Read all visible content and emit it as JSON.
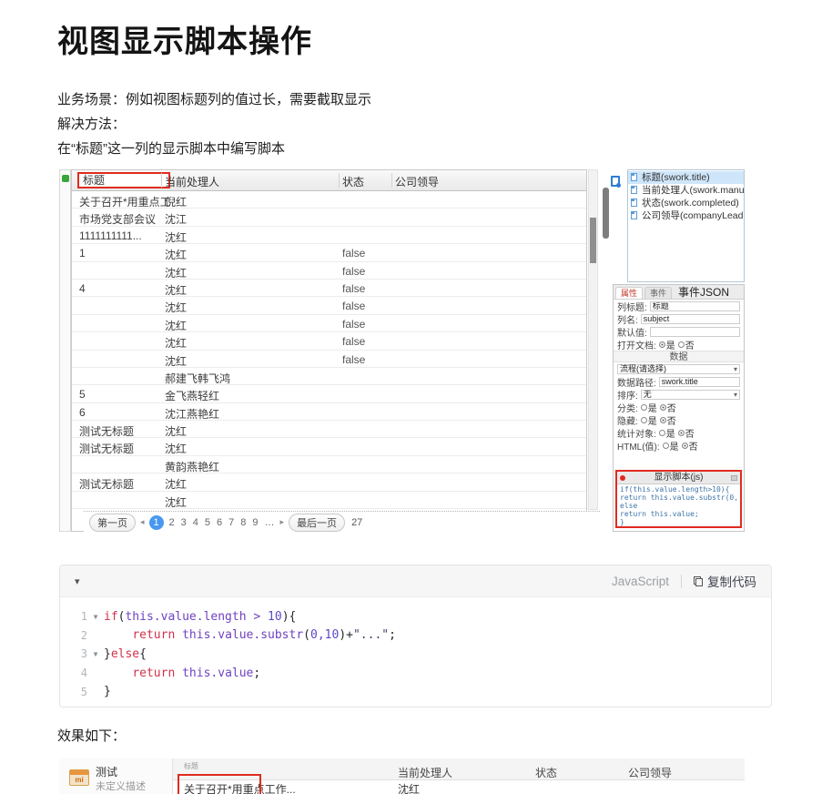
{
  "page": {
    "title": "视图显示脚本操作",
    "intro_line1": "业务场景：例如视图标题列的值过长，需要截取显示",
    "intro_line2": "解决方法：",
    "intro_line3": "在“标题”这一列的显示脚本中编写脚本",
    "effect_label": "效果如下："
  },
  "designer": {
    "columns": {
      "title": "标题",
      "handler": "当前处理人",
      "status": "状态",
      "leader": "公司领导"
    },
    "rows": [
      {
        "title": "关于召开*用重点工",
        "handler": "倪红",
        "status": ""
      },
      {
        "title": "市场党支部会议",
        "handler": "沈江",
        "status": ""
      },
      {
        "title": "1111111111...",
        "handler": "沈红",
        "status": ""
      },
      {
        "title": "1",
        "handler": "沈红",
        "status": "false"
      },
      {
        "title": "",
        "handler": "沈红",
        "status": "false"
      },
      {
        "title": "4",
        "handler": "沈红",
        "status": "false"
      },
      {
        "title": "",
        "handler": "沈红",
        "status": "false"
      },
      {
        "title": "",
        "handler": "沈红",
        "status": "false"
      },
      {
        "title": "",
        "handler": "沈红",
        "status": "false"
      },
      {
        "title": "",
        "handler": "沈红",
        "status": "false"
      },
      {
        "title": "",
        "handler": "郝建飞韩飞鸿",
        "status": ""
      },
      {
        "title": "5",
        "handler": "金飞燕轻红",
        "status": ""
      },
      {
        "title": "6",
        "handler": "沈江燕艳红",
        "status": ""
      },
      {
        "title": "测试无标题",
        "handler": "沈红",
        "status": ""
      },
      {
        "title": "测试无标题",
        "handler": "沈红",
        "status": ""
      },
      {
        "title": "",
        "handler": "黄韵燕艳红",
        "status": ""
      },
      {
        "title": "测试无标题",
        "handler": "沈红",
        "status": ""
      },
      {
        "title": "",
        "handler": "沈红",
        "status": ""
      }
    ],
    "pagination": {
      "first": "第一页",
      "prev": "◂",
      "pages": [
        "1",
        "2",
        "3",
        "4",
        "5",
        "6",
        "7",
        "8",
        "9"
      ],
      "current": "1",
      "ellipsis": "…",
      "next": "▸",
      "last": "最后一页",
      "total": "27"
    },
    "tree": [
      {
        "label": "标题(swork.title)",
        "selected": true
      },
      {
        "label": "当前处理人(swork.manual…",
        "selected": false
      },
      {
        "label": "状态(swork.completed)",
        "selected": false
      },
      {
        "label": "公司领导(companyLeader)",
        "selected": false
      }
    ],
    "props": {
      "tabs": [
        {
          "label": "属性",
          "active": true
        },
        {
          "label": "事件",
          "active": false
        }
      ],
      "panel_title": "事件JSON",
      "fields": [
        {
          "kind": "input",
          "label": "列标题:",
          "value": "标题"
        },
        {
          "kind": "input",
          "label": "列名:",
          "value": "subject"
        },
        {
          "kind": "input",
          "label": "默认值:",
          "value": ""
        },
        {
          "kind": "radio",
          "label": "打开文档:",
          "yes": "是",
          "no": "否",
          "sel": "yes"
        },
        {
          "kind": "section",
          "label": "数据"
        },
        {
          "kind": "select",
          "label": "",
          "value": "流程(请选择)"
        },
        {
          "kind": "input",
          "label": "数据路径:",
          "value": "swork.title"
        },
        {
          "kind": "select",
          "label": "排序:",
          "value": "无"
        },
        {
          "kind": "radio",
          "label": "分类:",
          "yes": "是",
          "no": "否",
          "sel": "no"
        },
        {
          "kind": "radio",
          "label": "隐藏:",
          "yes": "是",
          "no": "否",
          "sel": "no"
        },
        {
          "kind": "radio",
          "label": "统计对象:",
          "yes": "是",
          "no": "否",
          "sel": "no"
        },
        {
          "kind": "radio",
          "label": "HTML(值):",
          "yes": "是",
          "no": "否",
          "sel": "no"
        }
      ],
      "script_box": {
        "title": "显示脚本(js)",
        "code_lines": [
          "if(this.value.length>10){",
          "  return this.value.substr(0,",
          "else",
          "  return this.value;",
          "}"
        ]
      }
    }
  },
  "code_block": {
    "language": "JavaScript",
    "copy_label": "复制代码",
    "lines": [
      {
        "num": "1",
        "fold": true,
        "tokens": [
          {
            "t": "kw",
            "s": "if"
          },
          {
            "t": "pl",
            "s": "("
          },
          {
            "t": "id",
            "s": "this.value.length"
          },
          {
            "t": "pl",
            "s": " "
          },
          {
            "t": "id",
            "s": ">"
          },
          {
            "t": "pl",
            "s": " "
          },
          {
            "t": "num",
            "s": "10"
          },
          {
            "t": "pl",
            "s": "){"
          }
        ]
      },
      {
        "num": "2",
        "fold": false,
        "tokens": [
          {
            "t": "pl",
            "s": "    "
          },
          {
            "t": "kw",
            "s": "return"
          },
          {
            "t": "pl",
            "s": " "
          },
          {
            "t": "id",
            "s": "this.value.substr"
          },
          {
            "t": "pl",
            "s": "("
          },
          {
            "t": "num",
            "s": "0,10"
          },
          {
            "t": "pl",
            "s": ")+"
          },
          {
            "t": "str",
            "s": "\"...\""
          },
          {
            "t": "pl",
            "s": ";"
          }
        ]
      },
      {
        "num": "3",
        "fold": true,
        "tokens": [
          {
            "t": "pl",
            "s": "}"
          },
          {
            "t": "kw",
            "s": "else"
          },
          {
            "t": "pl",
            "s": "{"
          }
        ]
      },
      {
        "num": "4",
        "fold": false,
        "tokens": [
          {
            "t": "pl",
            "s": "    "
          },
          {
            "t": "kw",
            "s": "return"
          },
          {
            "t": "pl",
            "s": " "
          },
          {
            "t": "id",
            "s": "this.value"
          },
          {
            "t": "pl",
            "s": ";"
          }
        ]
      },
      {
        "num": "5",
        "fold": false,
        "tokens": [
          {
            "t": "pl",
            "s": "}"
          }
        ]
      }
    ]
  },
  "result": {
    "sidebar": {
      "icon_text": "mi",
      "title": "测试",
      "subtitle": "未定义描述"
    },
    "mini_header": "标题",
    "columns": {
      "handler": "当前处理人",
      "status": "状态",
      "leader": "公司领导"
    },
    "row": {
      "title": "关于召开*用重点工作...",
      "handler": "沈红"
    }
  },
  "colors": {
    "annotation_red": "#e02b20",
    "accent_blue": "#4898f0"
  }
}
